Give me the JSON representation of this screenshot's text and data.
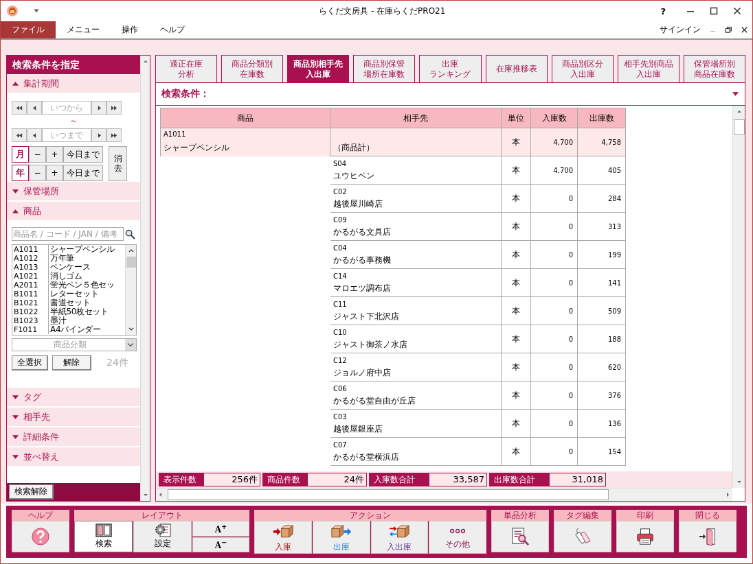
{
  "window": {
    "title": "らくだ文房具 - 在庫らくだPRO21",
    "help": "?"
  },
  "menu": {
    "items": [
      {
        "label": "ファイル",
        "selected": true
      },
      {
        "label": "メニュー",
        "selected": false
      },
      {
        "label": "操作",
        "selected": false
      },
      {
        "label": "ヘルプ",
        "selected": false
      }
    ],
    "signin": "サインイン"
  },
  "sidebar": {
    "title": "検索条件を指定",
    "period": {
      "label": "集計期間",
      "expanded": true,
      "from_placeholder": "いつから",
      "separator": "～",
      "to_placeholder": "いつまで",
      "units": [
        {
          "unit": "月",
          "minus": "−",
          "plus": "+",
          "today": "今日まで"
        },
        {
          "unit": "年",
          "minus": "−",
          "plus": "+",
          "today": "今日まで"
        }
      ],
      "clear": "消去"
    },
    "location": {
      "label": "保管場所",
      "expanded": false
    },
    "products": {
      "label": "商品",
      "expanded": true,
      "search_placeholder": "商品名 / コード / JAN / 備考",
      "items": [
        {
          "code": "A1011",
          "name": "シャープペンシル"
        },
        {
          "code": "A1012",
          "name": "万年筆"
        },
        {
          "code": "A1013",
          "name": "ペンケース"
        },
        {
          "code": "A1021",
          "name": "消しゴム"
        },
        {
          "code": "A2011",
          "name": "蛍光ペン５色セッ"
        },
        {
          "code": "B1011",
          "name": "レターセット"
        },
        {
          "code": "B1021",
          "name": "書道セット"
        },
        {
          "code": "B1022",
          "name": "半紙50枚セット"
        },
        {
          "code": "B1023",
          "name": "墨汁"
        },
        {
          "code": "F1011",
          "name": "A4バインダー"
        }
      ],
      "category_placeholder": "商品分類",
      "select_all": "全選択",
      "deselect": "解除",
      "count": "24件"
    },
    "more_sections": [
      {
        "label": "タグ",
        "expanded": false
      },
      {
        "label": "相手先",
        "expanded": false
      },
      {
        "label": "詳細条件",
        "expanded": false
      },
      {
        "label": "並べ替え",
        "expanded": false
      }
    ],
    "reset": "検索解除"
  },
  "tabs": [
    {
      "lines": [
        "適正在庫",
        "分析"
      ],
      "selected": false
    },
    {
      "lines": [
        "商品分類別",
        "在庫数"
      ],
      "selected": false
    },
    {
      "lines": [
        "商品別相手先",
        "入出庫"
      ],
      "selected": true
    },
    {
      "lines": [
        "商品別保管",
        "場所在庫数"
      ],
      "selected": false
    },
    {
      "lines": [
        "出庫",
        "ランキング"
      ],
      "selected": false
    },
    {
      "lines": [
        "在庫推移表"
      ],
      "selected": false
    },
    {
      "lines": [
        "商品別区分",
        "入出庫"
      ],
      "selected": false
    },
    {
      "lines": [
        "相手先別商品",
        "入出庫"
      ],
      "selected": false
    },
    {
      "lines": [
        "保管場所別",
        "商品在庫数"
      ],
      "selected": false
    }
  ],
  "criteria": {
    "label": "検索条件：",
    "expanded": false
  },
  "table": {
    "columns": [
      "商品",
      "相手先",
      "単位",
      "入庫数",
      "出庫数"
    ],
    "product": {
      "code": "A1011",
      "name": "シャープペンシル"
    },
    "rows": [
      {
        "kind": "total",
        "partner_code": "",
        "partner": "（商品計）",
        "unit": "本",
        "in": "4,700",
        "out": "4,758"
      },
      {
        "kind": "partner",
        "partner_code": "S04",
        "partner": "ユウヒペン",
        "unit": "本",
        "in": "4,700",
        "out": "405"
      },
      {
        "kind": "partner",
        "partner_code": "C02",
        "partner": "越後屋川崎店",
        "unit": "本",
        "in": "0",
        "out": "284"
      },
      {
        "kind": "partner",
        "partner_code": "C09",
        "partner": "かるがる文具店",
        "unit": "本",
        "in": "0",
        "out": "313"
      },
      {
        "kind": "partner",
        "partner_code": "C04",
        "partner": "かるがる事務機",
        "unit": "本",
        "in": "0",
        "out": "199"
      },
      {
        "kind": "partner",
        "partner_code": "C14",
        "partner": "マロエツ調布店",
        "unit": "本",
        "in": "0",
        "out": "141"
      },
      {
        "kind": "partner",
        "partner_code": "C11",
        "partner": "ジャスト下北沢店",
        "unit": "本",
        "in": "0",
        "out": "509"
      },
      {
        "kind": "partner",
        "partner_code": "C10",
        "partner": "ジャスト御茶ノ水店",
        "unit": "本",
        "in": "0",
        "out": "188"
      },
      {
        "kind": "partner",
        "partner_code": "C12",
        "partner": "ジョルノ府中店",
        "unit": "本",
        "in": "0",
        "out": "620"
      },
      {
        "kind": "partner",
        "partner_code": "C06",
        "partner": "かるがる堂自由が丘店",
        "unit": "本",
        "in": "0",
        "out": "376"
      },
      {
        "kind": "partner",
        "partner_code": "C03",
        "partner": "越後屋銀座店",
        "unit": "本",
        "in": "0",
        "out": "136"
      },
      {
        "kind": "partner",
        "partner_code": "C07",
        "partner": "かるがる堂横浜店",
        "unit": "本",
        "in": "0",
        "out": "154"
      }
    ]
  },
  "summary": [
    {
      "label": "表示件数",
      "value": "256件"
    },
    {
      "label": "商品件数",
      "value": "24件"
    },
    {
      "label": "入庫数合計",
      "value": "33,587"
    },
    {
      "label": "出庫数合計",
      "value": "31,018"
    }
  ],
  "toolbar": [
    {
      "label": "ヘルプ",
      "buttons": [
        {
          "kind": "help"
        }
      ]
    },
    {
      "label": "レイアウト",
      "buttons": [
        {
          "kind": "search",
          "label": "検索",
          "selected": true
        },
        {
          "kind": "settings",
          "label": "設定",
          "selected": false
        },
        {
          "kind": "font",
          "big": "A$^{+}$",
          "small": "A$^{−}$"
        }
      ]
    },
    {
      "label": "アクション",
      "buttons": [
        {
          "kind": "in",
          "label": "入庫"
        },
        {
          "kind": "out",
          "label": "出庫"
        },
        {
          "kind": "inout",
          "label": "入出庫"
        },
        {
          "kind": "other",
          "label": "その他"
        }
      ]
    },
    {
      "label": "単品分析",
      "buttons": [
        {
          "kind": "analysis"
        }
      ]
    },
    {
      "label": "タグ編集",
      "buttons": [
        {
          "kind": "tags"
        }
      ]
    },
    {
      "label": "印刷",
      "buttons": [
        {
          "kind": "print"
        }
      ]
    },
    {
      "label": "閉じる",
      "buttons": [
        {
          "kind": "close"
        }
      ]
    }
  ]
}
